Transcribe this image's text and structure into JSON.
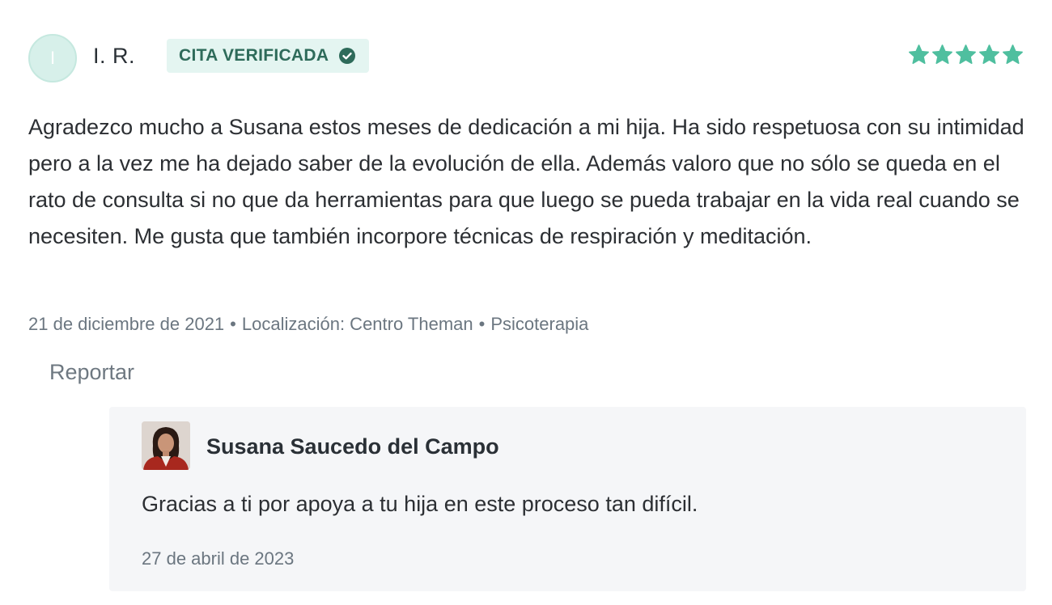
{
  "review": {
    "avatar_initial": "I",
    "author": "I. R.",
    "badge_label": "CITA VERIFICADA",
    "rating_stars": 5,
    "rating_max": 5,
    "star_color": "#4fbf9f",
    "body": "Agradezco mucho a Susana estos meses de dedicación a mi hija. Ha sido respetuosa con su intimidad pero a la vez me ha dejado saber de la evolución de ella. Además valoro que no sólo se queda en el rato de consulta si no que da herramientas para que luego se pueda trabajar en la vida real cuando se necesiten. Me gusta que también incorpore técnicas de respiración y meditación.",
    "date": "21 de diciembre de 2021",
    "location": "Localización: Centro Theman",
    "service": "Psicoterapia",
    "separator": "•",
    "report_label": "Reportar"
  },
  "reply": {
    "name": "Susana Saucedo del Campo",
    "text": "Gracias a ti por apoya a tu hija en este proceso tan difícil.",
    "date": "27 de abril de 2023"
  },
  "colors": {
    "accent": "#4fbf9f",
    "badge_bg": "#e4f5f1",
    "badge_text": "#2e6b5a",
    "reply_bg": "#f5f6f8"
  }
}
